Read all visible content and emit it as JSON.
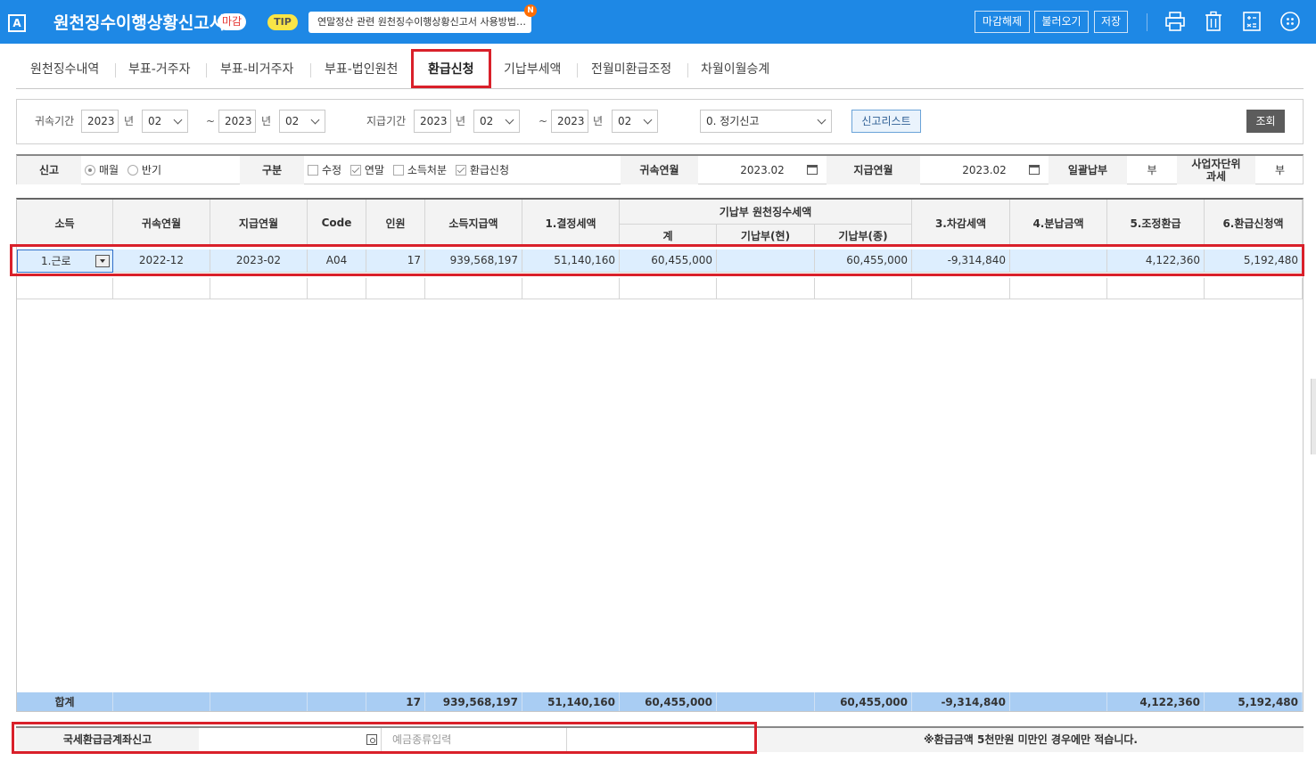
{
  "header": {
    "logo": "A",
    "title": "원천징수이행상황신고서",
    "status_badge": "마감",
    "tip_label": "TIP",
    "tip_message": "연말정산 관련 원천징수이행상황신고서 사용방법…",
    "tip_badge": "N",
    "buttons": {
      "unclose": "마감해제",
      "load": "불러오기",
      "save": "저장"
    },
    "icons": [
      "print-icon",
      "delete-icon",
      "calculator-icon",
      "apps-icon"
    ],
    "colors": {
      "bar": "#1e88e5",
      "highlight": "#d9202a"
    }
  },
  "tabs": [
    "원천징수내역",
    "부표-거주자",
    "부표-비거주자",
    "부표-법인원천",
    "환급신청",
    "기납부세액",
    "전월미환급조정",
    "차월이월승계"
  ],
  "active_tab": "환급신청",
  "filter": {
    "belong_label": "귀속기간",
    "pay_label": "지급기간",
    "year_unit": "년",
    "tilde": "~",
    "belong_from": {
      "year": "2023",
      "month": "02"
    },
    "belong_to": {
      "year": "2023",
      "month": "02"
    },
    "pay_from": {
      "year": "2023",
      "month": "02"
    },
    "pay_to": {
      "year": "2023",
      "month": "02"
    },
    "report_type": "0. 정기신고",
    "report_list_button": "신고리스트",
    "search_button": "조회"
  },
  "report": {
    "report_label": "신고",
    "monthly": "매월",
    "semi": "반기",
    "kind_label": "구분",
    "amend": "수정",
    "yearend": "연말",
    "income_disposal": "소득처분",
    "refund_apply": "환급신청",
    "belong_ym_label": "귀속연월",
    "belong_ym": "2023.02",
    "pay_ym_label": "지급연월",
    "pay_ym": "2023.02",
    "lump_label": "일괄납부",
    "lump_value": "부",
    "biz_unit_label_1": "사업자단위",
    "biz_unit_label_2": "과세",
    "biz_unit_value": "부"
  },
  "grid": {
    "headers": {
      "income": "소득",
      "belong_ym": "귀속연월",
      "pay_ym": "지급연월",
      "code": "Code",
      "people": "인원",
      "pay_amount": "소득지급액",
      "decided_tax": "1.결정세액",
      "prepaid_group": "기납부 원천징수세액",
      "prepaid_total": "계",
      "prepaid_current": "기납부(현)",
      "prepaid_former": "기납부(종)",
      "diff_tax": "3.차감세액",
      "installment": "4.분납금액",
      "adjusted_refund": "5.조정환급",
      "refund_request": "6.환급신청액"
    },
    "rows": [
      {
        "income": "1.근로",
        "belong_ym": "2022-12",
        "pay_ym": "2023-02",
        "code": "A04",
        "people": "17",
        "pay_amount": "939,568,197",
        "decided_tax": "51,140,160",
        "prepaid_total": "60,455,000",
        "prepaid_current": "",
        "prepaid_former": "60,455,000",
        "diff_tax": "-9,314,840",
        "installment": "",
        "adjusted_refund": "4,122,360",
        "refund_request": "5,192,480"
      }
    ],
    "total": {
      "label": "합계",
      "people": "17",
      "pay_amount": "939,568,197",
      "decided_tax": "51,140,160",
      "prepaid_total": "60,455,000",
      "prepaid_former": "60,455,000",
      "diff_tax": "-9,314,840",
      "adjusted_refund": "4,122,360",
      "refund_request": "5,192,480"
    }
  },
  "bottom": {
    "account_label": "국세환급금계좌신고",
    "bank_value": "",
    "deposit_placeholder": "예금종류입력",
    "account_number": "",
    "notice": "※환급금액 5천만원 미만인 경우에만 적습니다."
  }
}
